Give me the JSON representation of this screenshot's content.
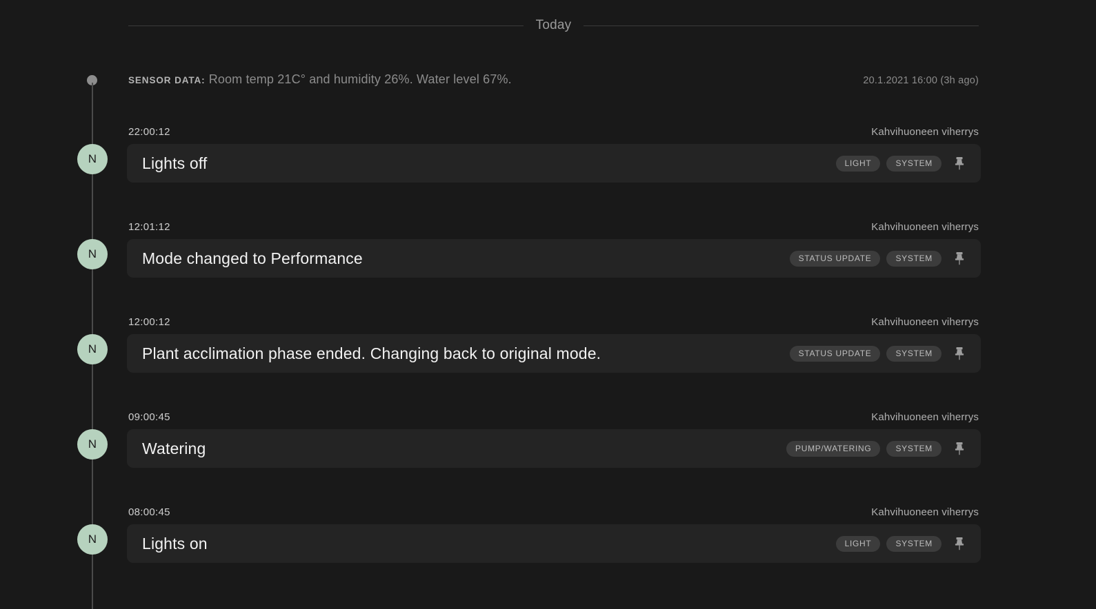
{
  "separator": {
    "label": "Today"
  },
  "sensor": {
    "kicker": "Sensor data:",
    "text": " Room temp 21C° and humidity 26%. Water level 67%.",
    "timestamp": "20.1.2021 16:00 (3h ago)"
  },
  "colors": {
    "page_bg": "#191919",
    "card_bg": "#242424",
    "avatar_bg": "#b6d2be",
    "tag_bg": "#3c3c3c",
    "rail": "#4a4a4a"
  },
  "icons": {
    "pin": "pin-icon"
  },
  "entries": [
    {
      "time": "22:00:12",
      "source": "Kahvihuoneen viherrys",
      "avatar": "N",
      "title": "Lights off",
      "tags": [
        "LIGHT",
        "SYSTEM"
      ]
    },
    {
      "time": "12:01:12",
      "source": "Kahvihuoneen viherrys",
      "avatar": "N",
      "title": "Mode changed to Performance",
      "tags": [
        "STATUS UPDATE",
        "SYSTEM"
      ]
    },
    {
      "time": "12:00:12",
      "source": "Kahvihuoneen viherrys",
      "avatar": "N",
      "title": "Plant acclimation phase ended. Changing back to original mode.",
      "tags": [
        "STATUS UPDATE",
        "SYSTEM"
      ]
    },
    {
      "time": "09:00:45",
      "source": "Kahvihuoneen viherrys",
      "avatar": "N",
      "title": "Watering",
      "tags": [
        "PUMP/WATERING",
        "SYSTEM"
      ]
    },
    {
      "time": "08:00:45",
      "source": "Kahvihuoneen viherrys",
      "avatar": "N",
      "title": "Lights on",
      "tags": [
        "LIGHT",
        "SYSTEM"
      ]
    }
  ]
}
